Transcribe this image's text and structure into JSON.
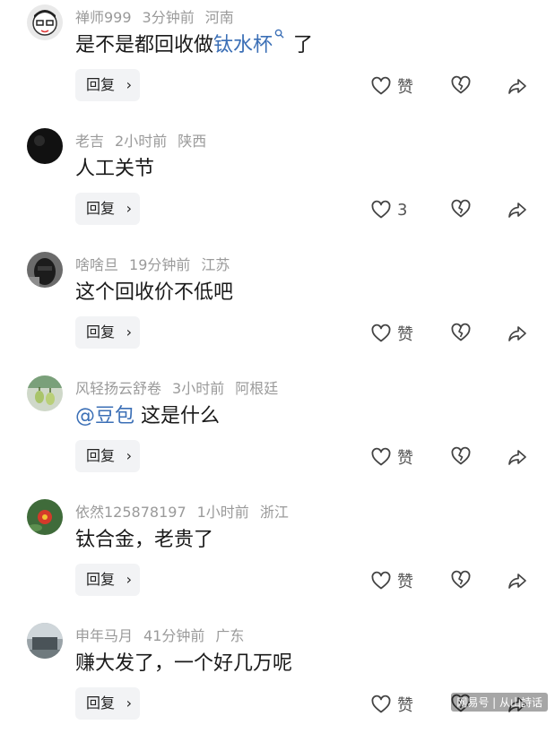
{
  "comments": [
    {
      "user": "禅师999",
      "time": "3分钟前",
      "location": "河南",
      "text_before": "是不是都回收做",
      "text_link": "钛水杯",
      "text_after": "了",
      "reply": "回复",
      "like": "赞"
    },
    {
      "user": "老吉",
      "time": "2小时前",
      "location": "陕西",
      "text": "人工关节",
      "reply": "回复",
      "like": "3"
    },
    {
      "user": "啥啥旦",
      "time": "19分钟前",
      "location": "江苏",
      "text": "这个回收价不低吧",
      "reply": "回复",
      "like": "赞"
    },
    {
      "user": "风轻扬云舒卷",
      "time": "3小时前",
      "location": "阿根廷",
      "mention": "@豆包",
      "text": "这是什么",
      "reply": "回复",
      "like": "赞"
    },
    {
      "user": "依然125878197",
      "time": "1小时前",
      "location": "浙江",
      "text": "钛合金，老贵了",
      "reply": "回复",
      "like": "赞"
    },
    {
      "user": "申年马月",
      "time": "41分钟前",
      "location": "广东",
      "text": "赚大发了，一个好几万呢",
      "reply": "回复",
      "like": "赞"
    }
  ],
  "watermark": "网易号 | 从山詩话",
  "colors": {
    "meta": "#9a9a9a",
    "link": "#3b6fb6",
    "reply_bg": "#f2f3f5"
  }
}
